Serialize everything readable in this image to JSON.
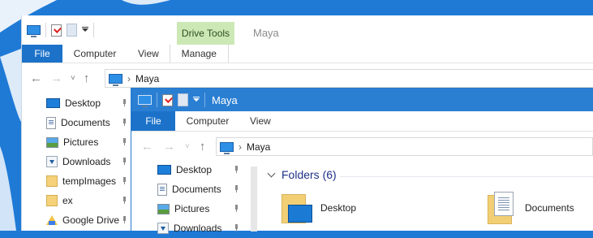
{
  "back_window": {
    "contextual_tab_group": "Drive Tools",
    "title": "Maya",
    "tabs": [
      "File",
      "Computer",
      "View",
      "Manage"
    ],
    "address": {
      "crumb": "Maya"
    },
    "nav_pane": [
      {
        "label": "Desktop",
        "icon": "desktop-icon"
      },
      {
        "label": "Documents",
        "icon": "documents-icon"
      },
      {
        "label": "Pictures",
        "icon": "pictures-icon"
      },
      {
        "label": "Downloads",
        "icon": "downloads-icon"
      },
      {
        "label": "tempImages",
        "icon": "folder-icon"
      },
      {
        "label": "ex",
        "icon": "folder-icon"
      },
      {
        "label": "Google Drive",
        "icon": "google-drive-icon"
      }
    ]
  },
  "front_window": {
    "title": "Maya",
    "tabs": [
      "File",
      "Computer",
      "View"
    ],
    "address": {
      "crumb": "Maya"
    },
    "nav_pane": [
      {
        "label": "Desktop",
        "icon": "desktop-icon"
      },
      {
        "label": "Documents",
        "icon": "documents-icon"
      },
      {
        "label": "Pictures",
        "icon": "pictures-icon"
      },
      {
        "label": "Downloads",
        "icon": "downloads-icon"
      }
    ],
    "group_header": "Folders (6)",
    "folders": [
      {
        "label": "Desktop",
        "icon": "desktop-folder-icon"
      },
      {
        "label": "Documents",
        "icon": "documents-folder-icon"
      }
    ]
  },
  "colors": {
    "wallpaper": "#1f7ad6",
    "file_tab": "#1c72c9",
    "active_title_bar": "#2b7fd3",
    "drive_tools": "#cbe8b5"
  }
}
